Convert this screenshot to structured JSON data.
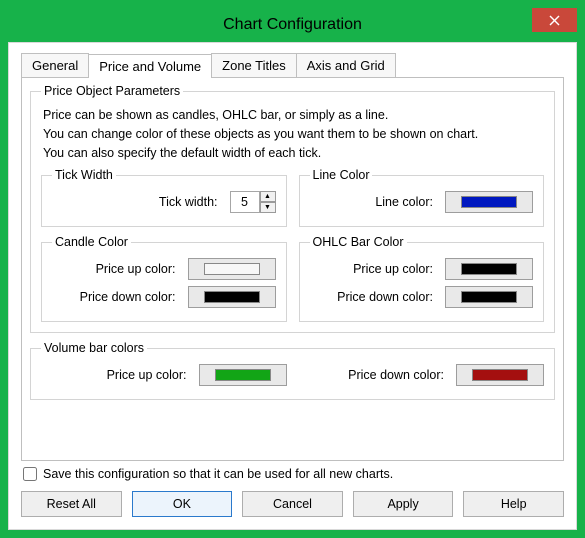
{
  "window": {
    "title": "Chart Configuration"
  },
  "tabs": {
    "general": "General",
    "price_volume": "Price and Volume",
    "zone_titles": "Zone Titles",
    "axis_grid": "Axis and Grid",
    "active": "price_volume"
  },
  "price_object": {
    "legend": "Price Object Parameters",
    "desc_line1": "Price can be shown as candles, OHLC bar, or simply as a line.",
    "desc_line2": "You can change color of these objects as you want them to be shown on chart.",
    "desc_line3": "You can also specify the default width of each tick."
  },
  "tick_width": {
    "legend": "Tick Width",
    "label": "Tick width:",
    "value": "5"
  },
  "line_color": {
    "legend": "Line Color",
    "label": "Line color:",
    "color": "#0018c0"
  },
  "candle_color": {
    "legend": "Candle Color",
    "up_label": "Price up color:",
    "up_color": "#f7f7f7",
    "down_label": "Price down color:",
    "down_color": "#000000"
  },
  "ohlc_color": {
    "legend": "OHLC Bar Color",
    "up_label": "Price up color:",
    "up_color": "#000000",
    "down_label": "Price down color:",
    "down_color": "#000000"
  },
  "volume_color": {
    "legend": "Volume bar colors",
    "up_label": "Price up color:",
    "up_color": "#12a516",
    "down_label": "Price down color:",
    "down_color": "#a40f0f"
  },
  "save_checkbox": {
    "label": "Save this configuration so that it can be used for all new charts.",
    "checked": false
  },
  "buttons": {
    "reset": "Reset All",
    "ok": "OK",
    "cancel": "Cancel",
    "apply": "Apply",
    "help": "Help"
  }
}
